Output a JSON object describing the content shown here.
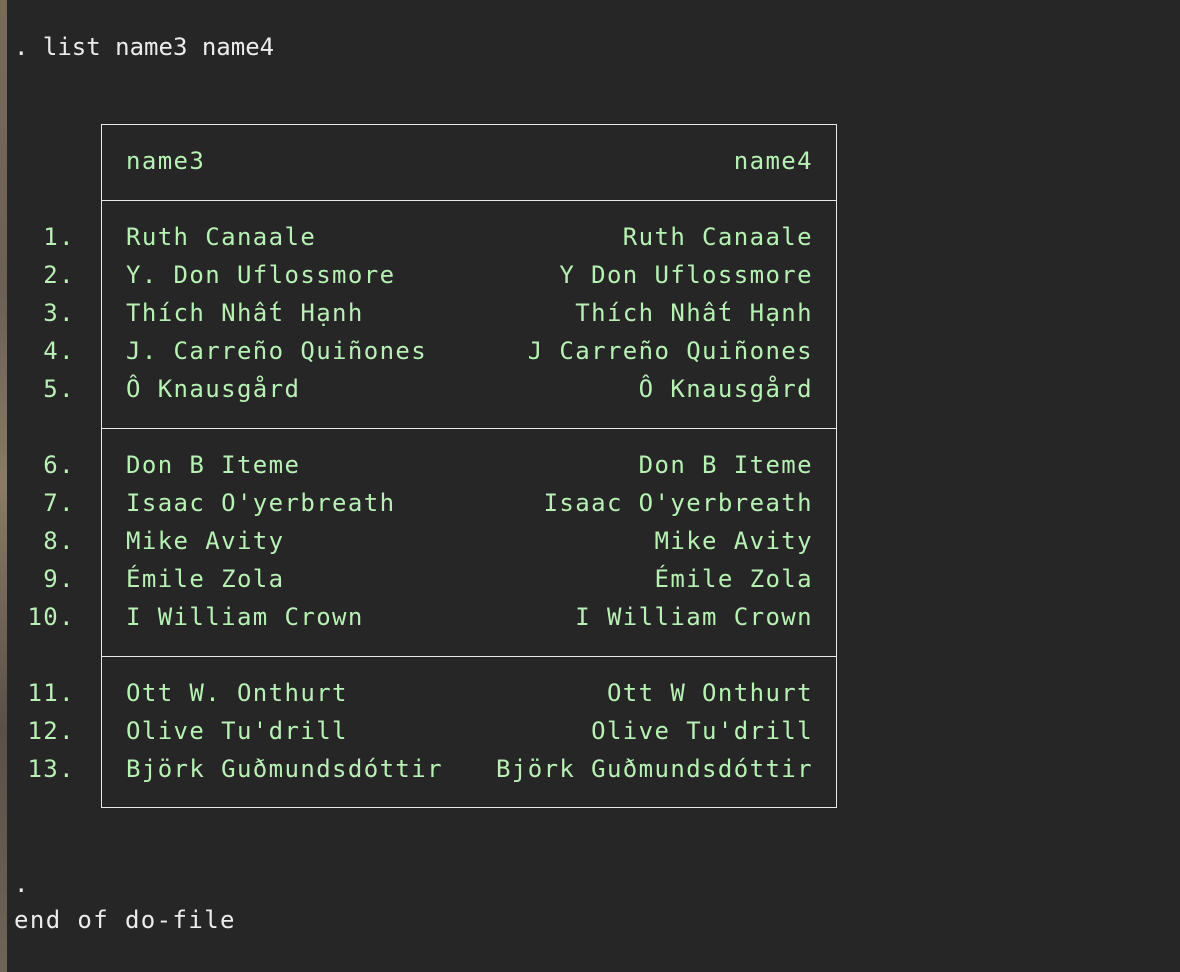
{
  "command": {
    "prompt": ".",
    "text": "list name3 name4"
  },
  "table": {
    "headers": [
      "name3",
      "name4"
    ],
    "groups": [
      [
        {
          "num": "1.",
          "name3": "Ruth Canaale",
          "name4": "Ruth Canaale"
        },
        {
          "num": "2.",
          "name3": "Y. Don Uflossmore",
          "name4": "Y Don Uflossmore"
        },
        {
          "num": "3.",
          "name3": "Thích Nhất Hạnh",
          "name4": "Thích Nhất Hạnh"
        },
        {
          "num": "4.",
          "name3": "J. Carreño Quiñones",
          "name4": "J Carreño Quiñones"
        },
        {
          "num": "5.",
          "name3": "Ô Knausgård",
          "name4": "Ô Knausgård"
        }
      ],
      [
        {
          "num": "6.",
          "name3": "Don B Iteme",
          "name4": "Don B Iteme"
        },
        {
          "num": "7.",
          "name3": "Isaac O'yerbreath",
          "name4": "Isaac O'yerbreath"
        },
        {
          "num": "8.",
          "name3": "Mike Avity",
          "name4": "Mike Avity"
        },
        {
          "num": "9.",
          "name3": "Émile Zola",
          "name4": "Émile Zola"
        },
        {
          "num": "10.",
          "name3": "I William Crown",
          "name4": "I William Crown"
        }
      ],
      [
        {
          "num": "11.",
          "name3": "Ott W. Onthurt",
          "name4": "Ott W Onthurt"
        },
        {
          "num": "12.",
          "name3": "Olive Tu'drill",
          "name4": "Olive Tu'drill"
        },
        {
          "num": "13.",
          "name3": "Björk Guðmundsdóttir",
          "name4": "Björk Guðmundsdóttir"
        }
      ]
    ]
  },
  "footer": {
    "prompt": ".",
    "message": "end of do-file"
  },
  "colors": {
    "background": "#262626",
    "output_text": "#b7f1b4",
    "command_text": "#ececec",
    "table_border": "#e8e8e8"
  }
}
